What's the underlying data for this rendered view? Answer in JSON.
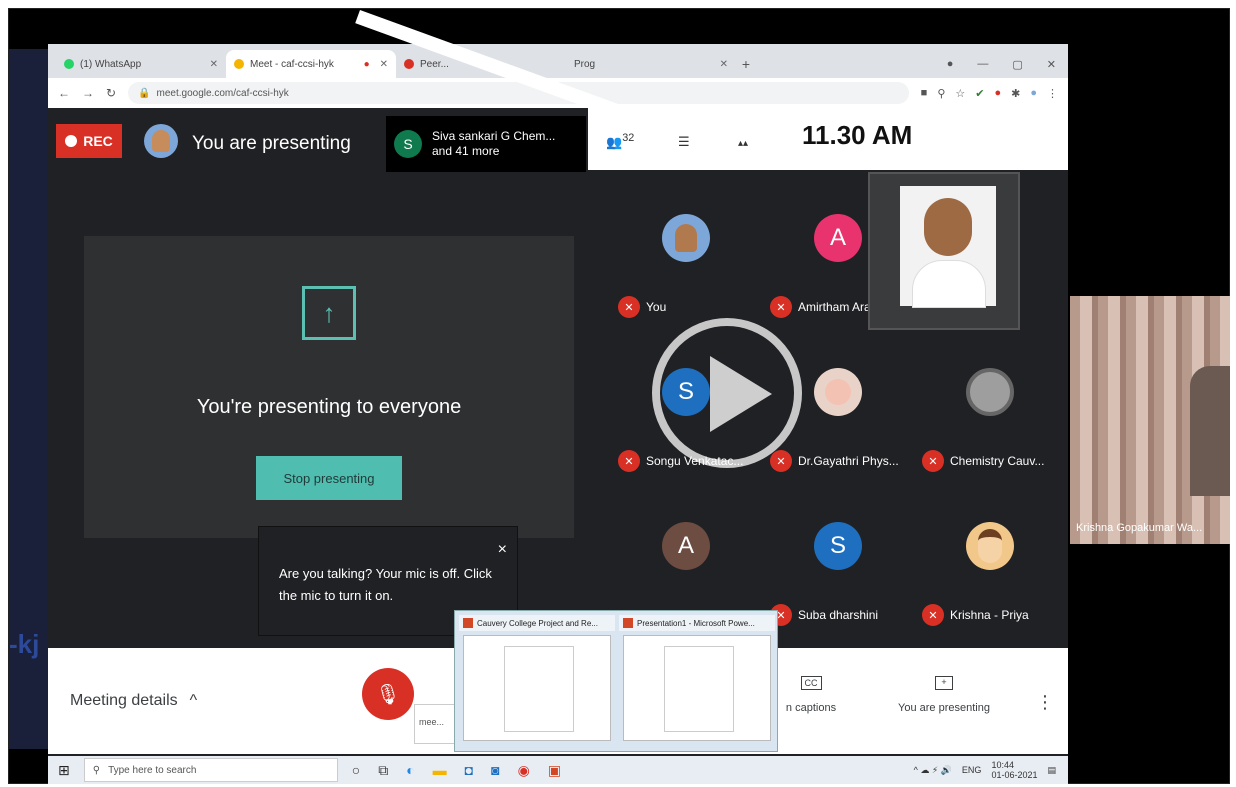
{
  "browser": {
    "tabs": [
      {
        "label": "(1) WhatsApp",
        "color": "#25d366"
      },
      {
        "label": "Meet - caf-ccsi-hyk",
        "color": "#f4b400"
      },
      {
        "label": "Peer...",
        "color": "#d93025"
      },
      {
        "label": "Prog",
        "color": "#888888"
      }
    ],
    "new_tab": "+",
    "url": "meet.google.com/caf-ccsi-hyk"
  },
  "meet": {
    "rec_label": "REC",
    "presenter_status": "You are presenting",
    "joined_avatar": "S",
    "joined_text_line1": "Siva sankari G Chem...",
    "joined_text_line2": "and 41 more",
    "people_count": "32",
    "clock": "11.30 AM",
    "presenting_message": "You're presenting to everyone",
    "stop_button": "Stop presenting",
    "tooltip": "Are you talking? Your mic is off. Click the mic to turn it on.",
    "tooltip_close": "×"
  },
  "participants": [
    {
      "name": "You",
      "avatar": "",
      "avatar_color": "#7da7d9"
    },
    {
      "name": "Amirtham Arasu",
      "avatar": "A",
      "avatar_color": "#e8336e"
    },
    {
      "name": "Songu Venkatac...",
      "avatar": "S",
      "avatar_color": "#1e6fbf"
    },
    {
      "name": "Dr.Gayathri Phys...",
      "avatar": "",
      "avatar_color": "#e9d3c9"
    },
    {
      "name": "Chemistry Cauv...",
      "avatar": "",
      "avatar_color": "#9e9e9e"
    },
    {
      "name": "",
      "avatar": "A",
      "avatar_color": "#6d4c41"
    },
    {
      "name": "Suba dharshini",
      "avatar": "S",
      "avatar_color": "#1e6fbf"
    },
    {
      "name": "Krishna - Priya",
      "avatar": "",
      "avatar_color": "#f2c78a"
    }
  ],
  "side_video": {
    "label": "Krishna Gopakumar Wa..."
  },
  "controls": {
    "meeting_details": "Meeting details",
    "captions": "n captions",
    "captions_icon": "CC",
    "presenting": "You are presenting",
    "present_icon": "+",
    "more": "⋮",
    "mini_dialog": "mee..."
  },
  "thumbnails": [
    {
      "title": "Cauvery College Project and Re..."
    },
    {
      "title": "Presentation1 - Microsoft Powe..."
    }
  ],
  "taskbar": {
    "search_placeholder": "Type here to search",
    "time": "10:44",
    "date": "01-06-2021",
    "lang": "ENG"
  }
}
